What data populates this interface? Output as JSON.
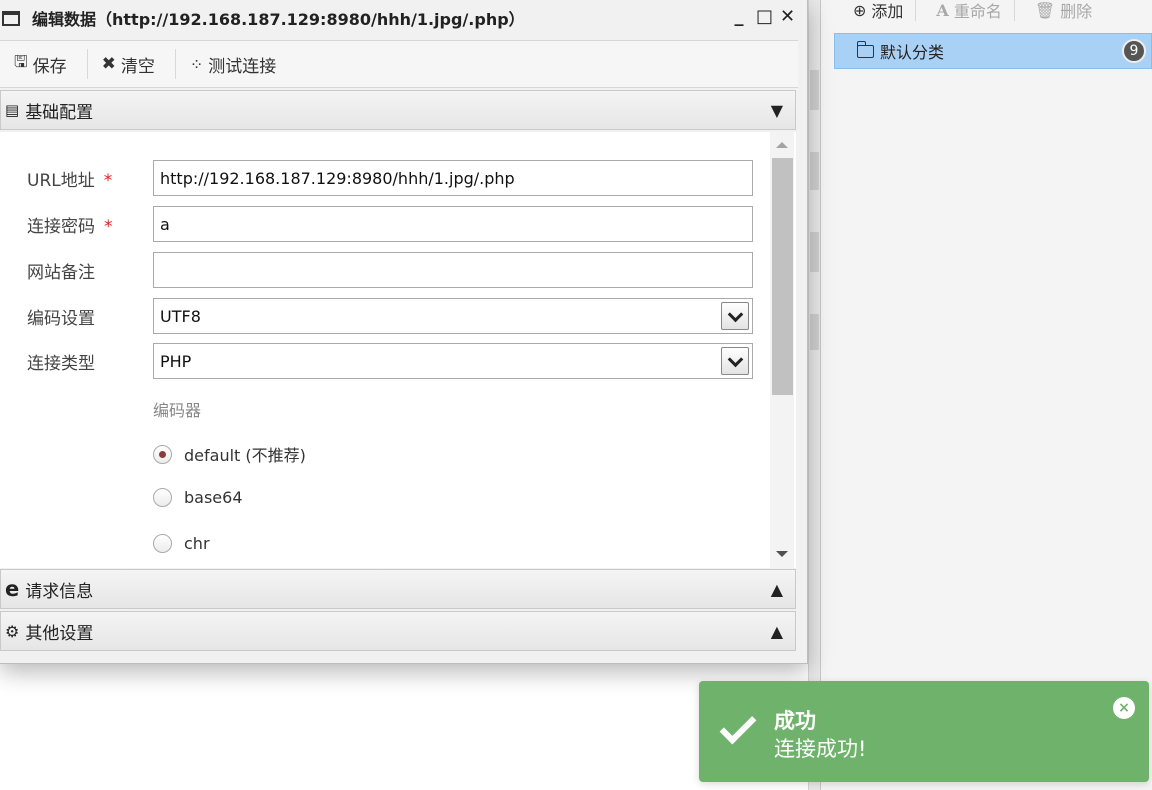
{
  "dialog": {
    "title": "编辑数据（http://192.168.187.129:8980/hhh/1.jpg/.php）",
    "controls": {
      "minimize": "_",
      "maximize": "□",
      "close": "✕"
    }
  },
  "toolbar": {
    "save_label": "保存",
    "clear_label": "清空",
    "test_label": "测试连接"
  },
  "sections": {
    "basic": {
      "title": "基础配置",
      "expanded": true
    },
    "request": {
      "title": "请求信息",
      "expanded": false
    },
    "other": {
      "title": "其他设置",
      "expanded": false
    }
  },
  "form": {
    "url": {
      "label": "URL地址",
      "required": "*",
      "value": "http://192.168.187.129:8980/hhh/1.jpg/.php"
    },
    "password": {
      "label": "连接密码",
      "required": "*",
      "value": "a"
    },
    "note": {
      "label": "网站备注",
      "value": ""
    },
    "encoding": {
      "label": "编码设置",
      "value": "UTF8"
    },
    "conn_type": {
      "label": "连接类型",
      "value": "PHP"
    },
    "encoder": {
      "title": "编码器",
      "options": [
        {
          "label": "default (不推荐)",
          "selected": true
        },
        {
          "label": "base64",
          "selected": false
        },
        {
          "label": "chr",
          "selected": false
        }
      ]
    }
  },
  "category_panel": {
    "toolbar": {
      "add_label": "添加",
      "rename_label": "重命名",
      "delete_label": "删除"
    },
    "items": [
      {
        "label": "默认分类",
        "count": "9"
      }
    ]
  },
  "toast": {
    "title": "成功",
    "message": "连接成功!",
    "close": "×",
    "color": "#6fb26b"
  }
}
